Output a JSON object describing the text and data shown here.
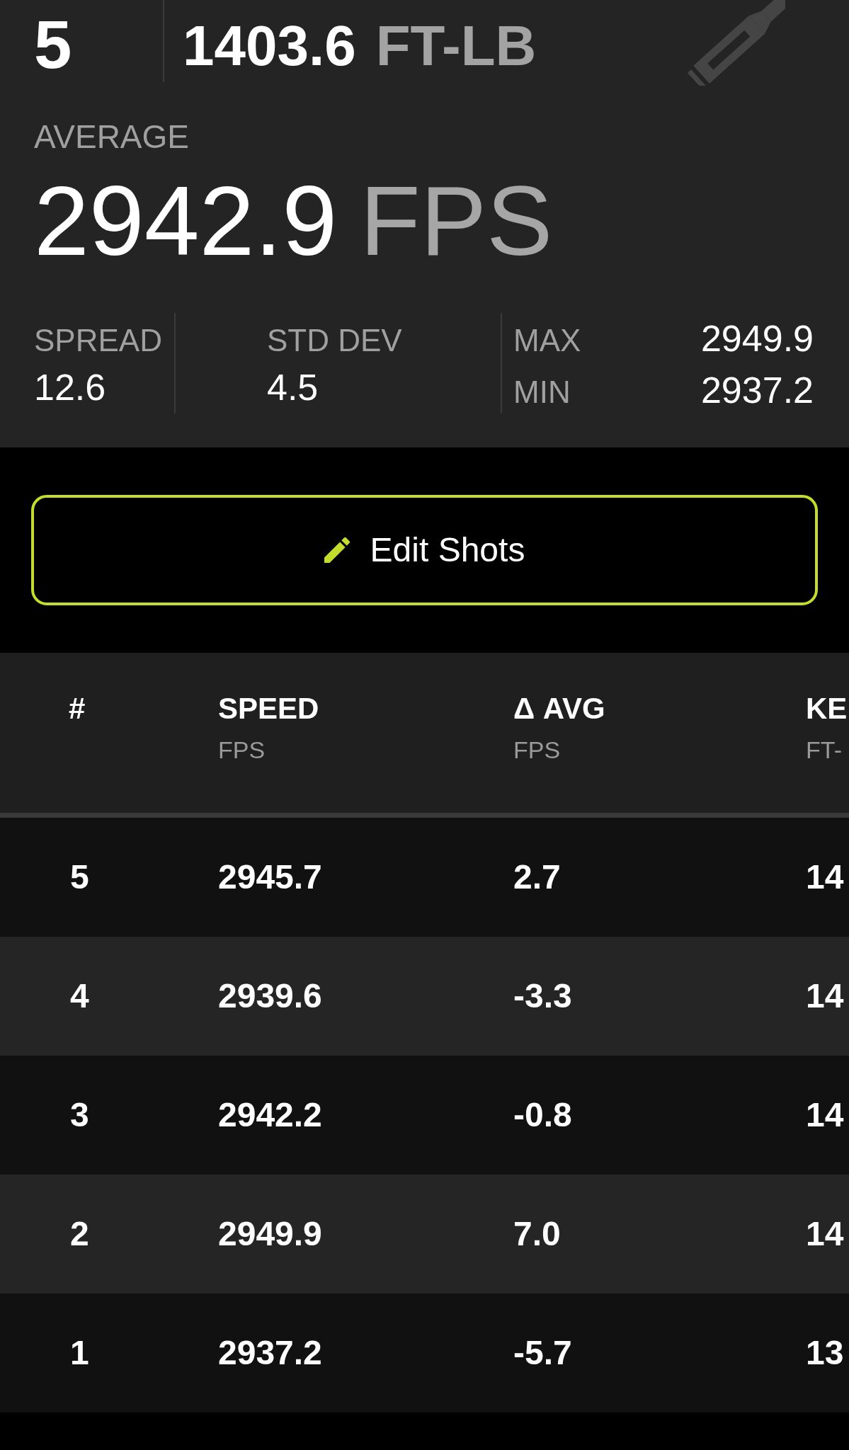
{
  "summary": {
    "count": "5",
    "energy": {
      "value": "1403.6",
      "unit": "FT-LB"
    },
    "average": {
      "label": "AVERAGE",
      "value": "2942.9",
      "unit": "FPS"
    },
    "stats": [
      {
        "label": "SPREAD",
        "value": "12.6"
      },
      {
        "label": "STD DEV",
        "value": "4.5"
      }
    ],
    "range": [
      {
        "label": "MAX",
        "value": "2949.9"
      },
      {
        "label": "MIN",
        "value": "2937.2"
      }
    ]
  },
  "edit_button": {
    "label": "Edit Shots"
  },
  "table": {
    "columns": [
      {
        "title": "#"
      },
      {
        "title": "SPEED",
        "unit": "FPS"
      },
      {
        "title": "Δ AVG",
        "unit": "FPS"
      },
      {
        "title": "KE",
        "unit": "FT-"
      }
    ],
    "rows": [
      [
        "5",
        "2945.7",
        "2.7",
        "14"
      ],
      [
        "4",
        "2939.6",
        "-3.3",
        "14"
      ],
      [
        "3",
        "2942.2",
        "-0.8",
        "14"
      ],
      [
        "2",
        "2949.9",
        "7.0",
        "14"
      ],
      [
        "1",
        "2937.2",
        "-5.7",
        "13"
      ]
    ]
  }
}
